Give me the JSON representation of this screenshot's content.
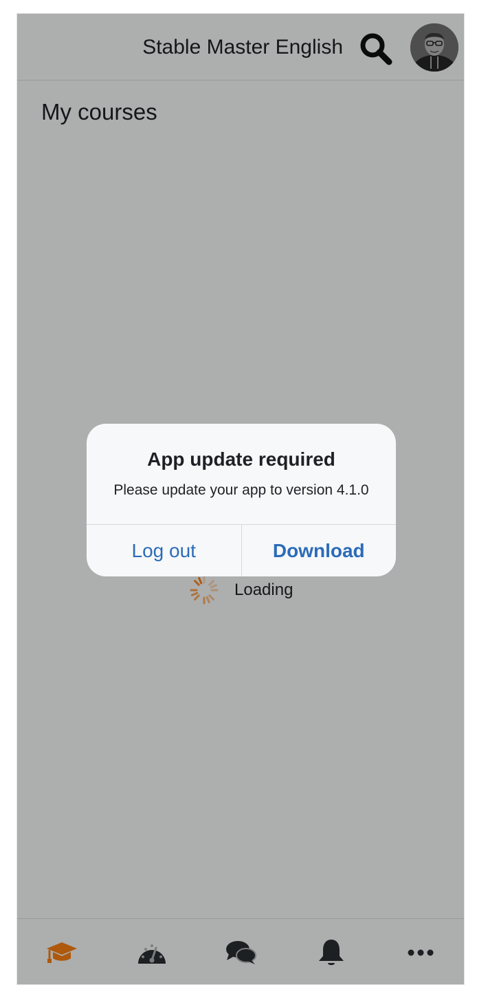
{
  "header": {
    "site_name": "Stable Master English",
    "search_icon": "search-icon",
    "avatar": "user-avatar"
  },
  "page": {
    "title": "My courses"
  },
  "loading": {
    "label": "Loading"
  },
  "dialog": {
    "title": "App update required",
    "message": "Please update your app to version 4.1.0",
    "secondary_button": "Log out",
    "primary_button": "Download"
  },
  "tabbar": {
    "items": [
      {
        "icon": "graduation-cap-icon",
        "active": true
      },
      {
        "icon": "dashboard-icon",
        "active": false
      },
      {
        "icon": "messages-icon",
        "active": false
      },
      {
        "icon": "bell-icon",
        "active": false
      },
      {
        "icon": "more-icon",
        "active": false
      }
    ]
  },
  "colors": {
    "accent": "#f98012",
    "link": "#2b6cb8",
    "text": "#1d2125",
    "background": "#f8f9fa"
  }
}
